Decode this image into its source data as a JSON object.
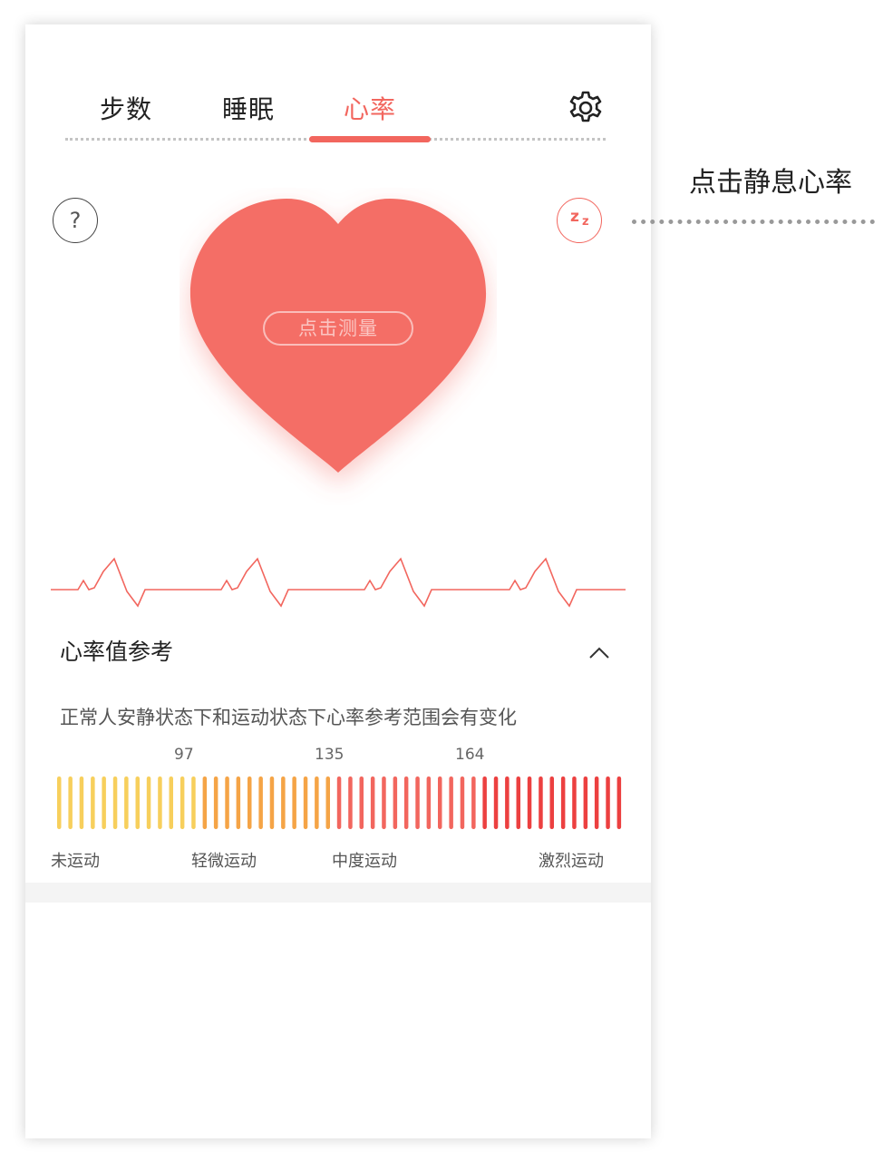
{
  "tabs": [
    {
      "label": "步数",
      "active": false
    },
    {
      "label": "睡眠",
      "active": false
    },
    {
      "label": "心率",
      "active": true
    }
  ],
  "icons": {
    "settings": "gear-icon",
    "help": "question-icon",
    "help_glyph": "?",
    "resting": "sleep-zz-icon",
    "resting_glyph_big": "z",
    "resting_glyph_small": "z"
  },
  "heart": {
    "measure_label": "点击测量",
    "color": "#f2665e"
  },
  "reference": {
    "title": "心率值参考",
    "description": "正常人安静状态下和运动状态下心率参考范围会有变化",
    "thresholds": [
      "97",
      "135",
      "164"
    ],
    "levels": [
      "未运动",
      "轻微运动",
      "中度运动",
      "激烈运动"
    ],
    "scale_colors": [
      "#f7cf5c",
      "#f5a446",
      "#f2665e",
      "#ec4040"
    ]
  },
  "annotation": {
    "label": "点击静息心率"
  }
}
